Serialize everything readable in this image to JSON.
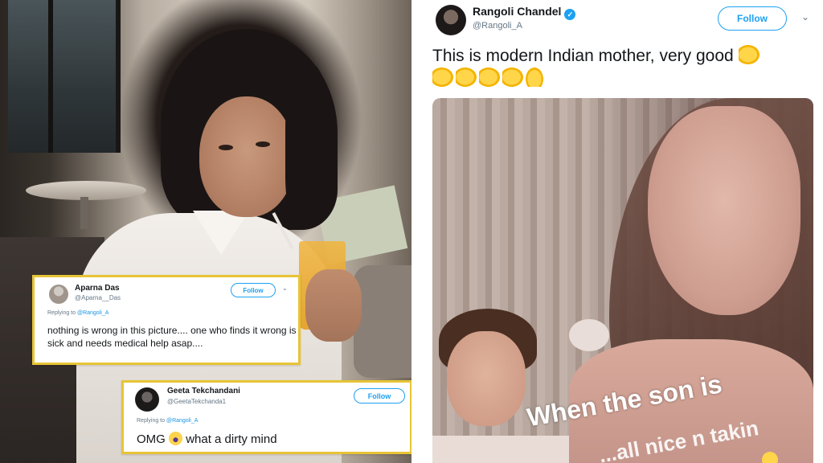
{
  "left_photo": {
    "card_1": {
      "name": "Aparna Das",
      "handle": "@Aparna__Das",
      "follow_label": "Follow",
      "reply_prefix": "Replying to ",
      "reply_mention": "@Rangoli_A",
      "text": "nothing is wrong in this picture.... one who finds it wrong is sick and needs medical help asap...."
    },
    "card_2": {
      "name": "Geeta Tekchandani",
      "handle": "@GeetaTekchanda1",
      "follow_label": "Follow",
      "reply_prefix": "Replying to ",
      "reply_mention": "@Rangoli_A",
      "text_before": "OMG",
      "emoji": "scream-emoji",
      "text_after": "what a dirty mind"
    }
  },
  "main_tweet": {
    "name": "Rangoli Chandel",
    "verified_icon": "verified-badge-icon",
    "handle": "@Rangoli_A",
    "follow_label": "Follow",
    "text": "This is modern Indian mother, very good",
    "emojis": [
      "clapping-hands-icon",
      "clapping-hands-icon",
      "clapping-hands-icon",
      "clapping-hands-icon",
      "clapping-hands-icon",
      "thumbs-up-icon"
    ],
    "photo_caption_line1": "When the son is",
    "photo_caption_line2": "...all nice n takin"
  },
  "colors": {
    "highlight_border": "#e7c436",
    "twitter_blue": "#1da1f2"
  }
}
